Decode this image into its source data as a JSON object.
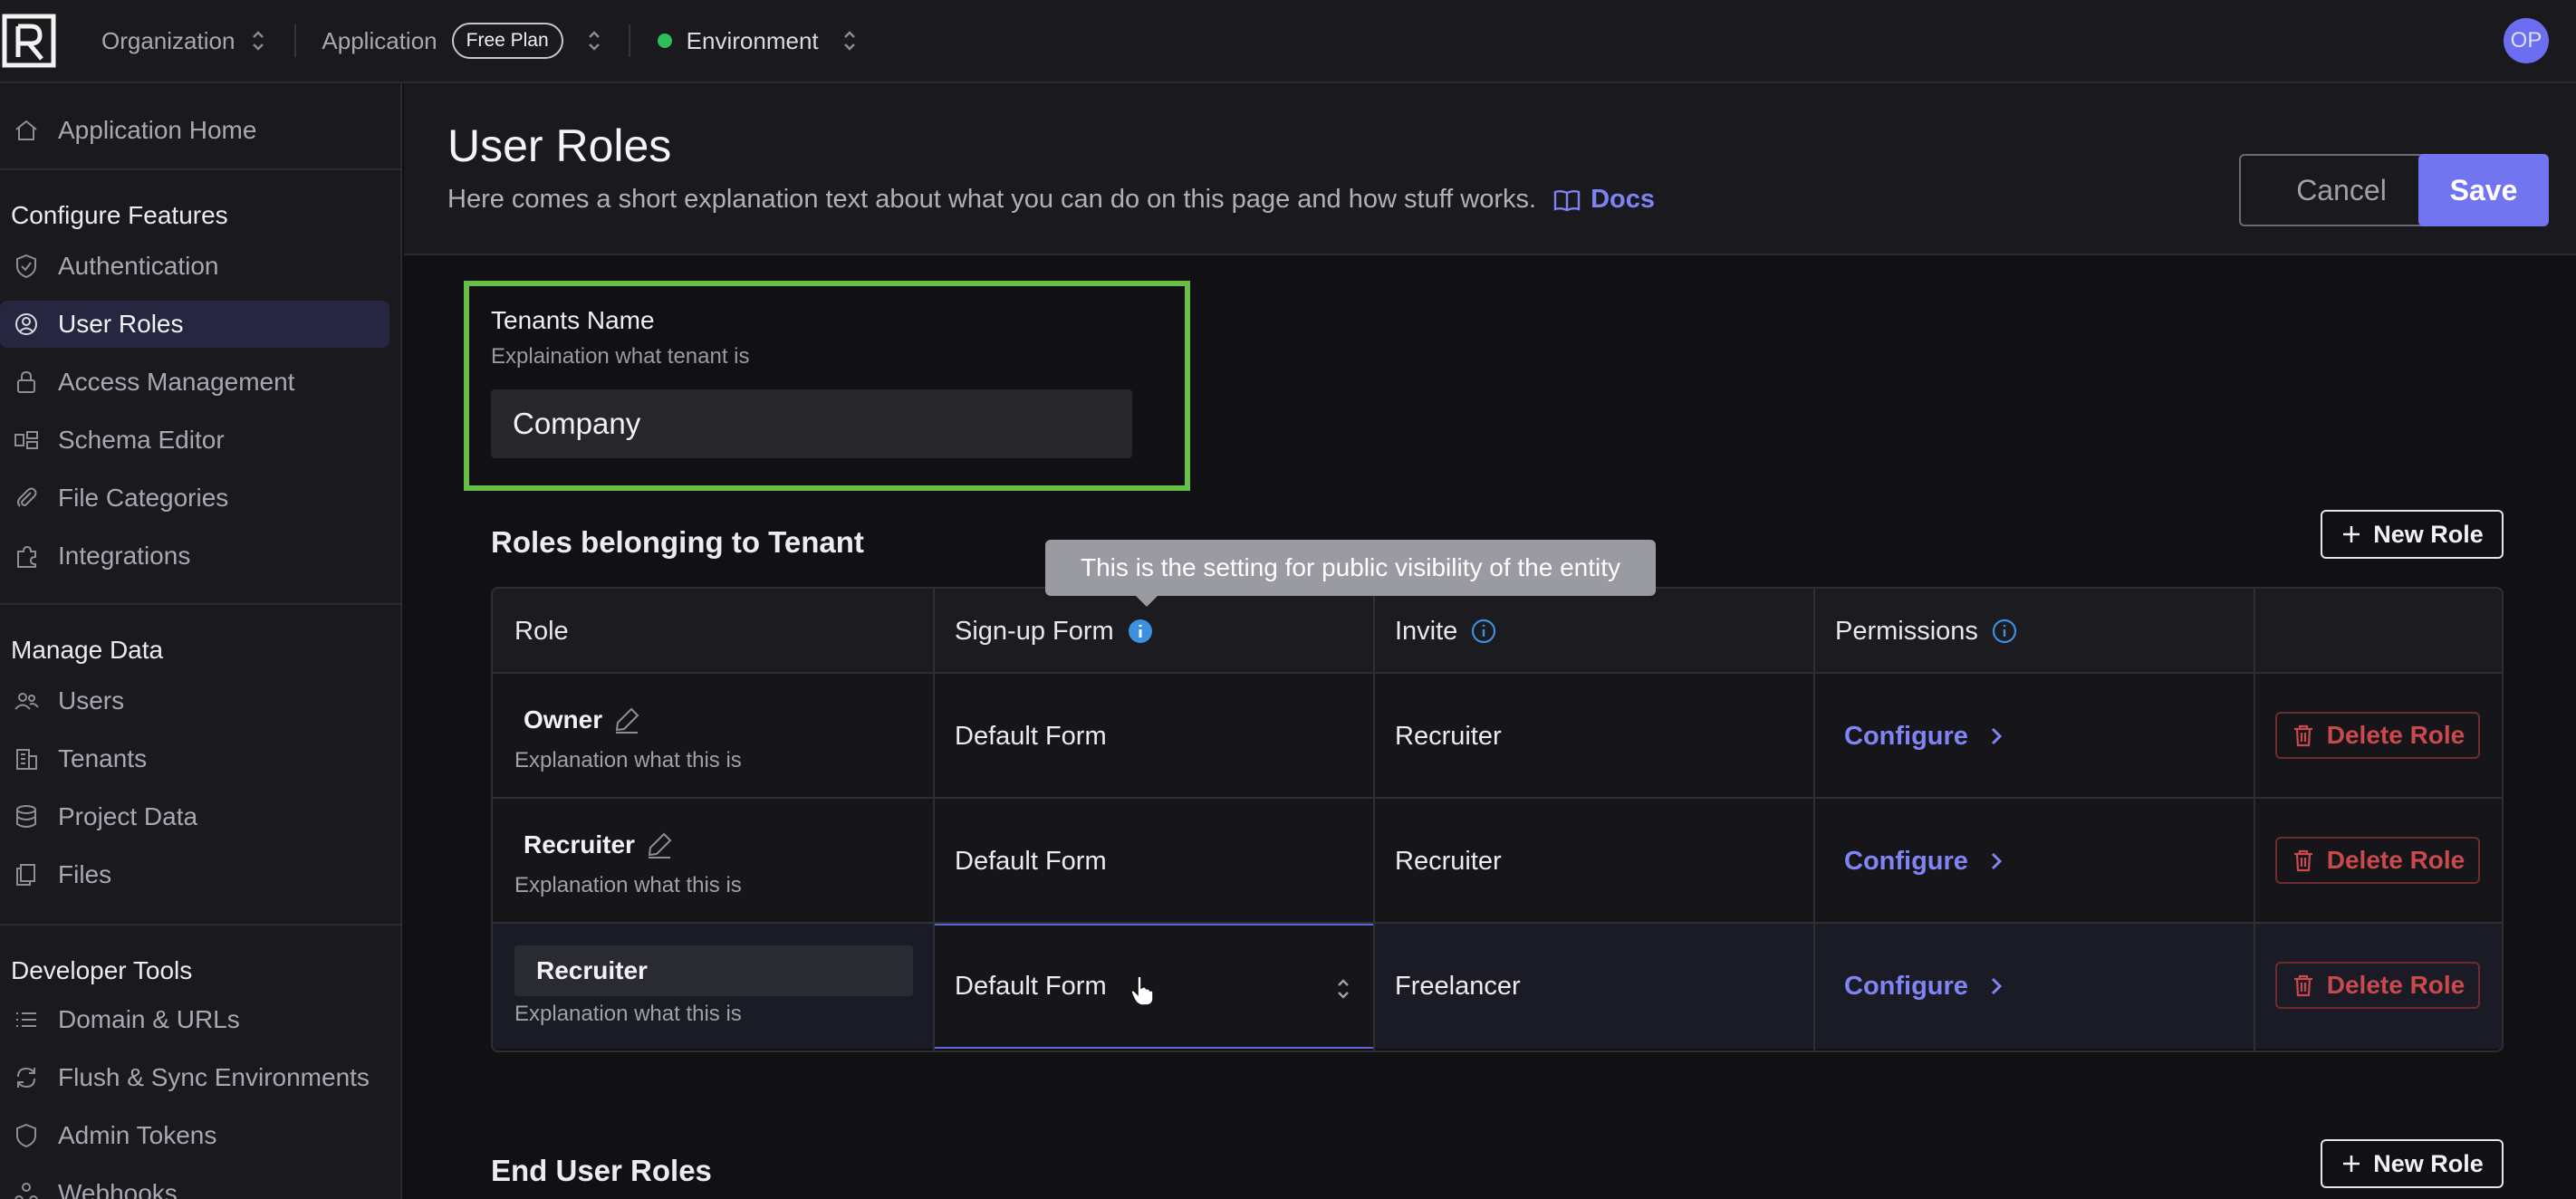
{
  "topbar": {
    "logo": "R",
    "organization": "Organization",
    "application": "Application",
    "plan_badge": "Free Plan",
    "environment": "Environment",
    "avatar_initials": "OP"
  },
  "sidebar": {
    "home": "Application Home",
    "configure_heading": "Configure Features",
    "configure_items": [
      {
        "label": "Authentication",
        "icon": "shield-check-icon"
      },
      {
        "label": "User Roles",
        "icon": "user-circle-icon"
      },
      {
        "label": "Access Management",
        "icon": "lock-icon"
      },
      {
        "label": "Schema Editor",
        "icon": "schema-icon"
      },
      {
        "label": "File Categories",
        "icon": "paperclip-icon"
      },
      {
        "label": "Integrations",
        "icon": "puzzle-icon"
      }
    ],
    "manage_heading": "Manage Data",
    "manage_items": [
      {
        "label": "Users",
        "icon": "users-icon"
      },
      {
        "label": "Tenants",
        "icon": "building-icon"
      },
      {
        "label": "Project Data",
        "icon": "database-icon"
      },
      {
        "label": "Files",
        "icon": "files-icon"
      }
    ],
    "dev_heading": "Developer Tools",
    "dev_items": [
      {
        "label": "Domain & URLs",
        "icon": "list-icon"
      },
      {
        "label": "Flush & Sync Environments",
        "icon": "sync-icon"
      },
      {
        "label": "Admin Tokens",
        "icon": "shield-icon"
      },
      {
        "label": "Webhooks",
        "icon": "webhook-icon"
      }
    ]
  },
  "header": {
    "title": "User Roles",
    "subtitle": "Here comes a short explanation text about what you can do on this page and how stuff works.",
    "docs": "Docs",
    "cancel": "Cancel",
    "save": "Save"
  },
  "tenant": {
    "label": "Tenants Name",
    "help": "Explaination what tenant is",
    "value": "Company"
  },
  "roles_section": {
    "title": "Roles belonging to Tenant",
    "new_role": "New Role",
    "tooltip": "This is the setting for public visibility of the entity",
    "columns": [
      "Role",
      "Sign-up Form",
      "Invite",
      "Permissions"
    ],
    "rows": [
      {
        "name": "Owner",
        "help": "Explanation what this is",
        "signup": "Default Form",
        "invite": "Recruiter",
        "permissions": "Configure",
        "delete": "Delete Role"
      },
      {
        "name": "Recruiter",
        "help": "Explanation what this is",
        "signup": "Default Form",
        "invite": "Recruiter",
        "permissions": "Configure",
        "delete": "Delete Role"
      },
      {
        "name": "Recruiter",
        "help": "Explanation what this is",
        "signup": "Default Form",
        "invite": "Freelancer",
        "permissions": "Configure",
        "delete": "Delete Role"
      }
    ]
  },
  "end_user_section": {
    "title": "End User Roles",
    "new_role": "New Role"
  },
  "colors": {
    "accent": "#7175ef",
    "highlight_border": "#67bf47",
    "danger": "#c9494c",
    "env_status": "#2fbf5a"
  }
}
